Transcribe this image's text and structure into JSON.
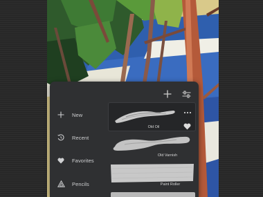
{
  "toolbar": {
    "add_icon": "plus-icon",
    "settings_icon": "sliders-icon"
  },
  "sidebar": {
    "items": [
      {
        "label": "New",
        "icon": "plus-icon"
      },
      {
        "label": "Recent",
        "icon": "history-icon"
      },
      {
        "label": "Favorites",
        "icon": "heart-icon"
      },
      {
        "label": "Pencils",
        "icon": "triangle-icon"
      }
    ]
  },
  "brushes": [
    {
      "name": "Old Oil",
      "selected": true,
      "favorite": true
    },
    {
      "name": "Old Varnish"
    },
    {
      "name": "Paint Roller"
    }
  ],
  "colors": {
    "panel": "#2f3032",
    "text": "#cfd0d2",
    "stroke": "#bdbdbd",
    "sky": "#2f5fae"
  }
}
